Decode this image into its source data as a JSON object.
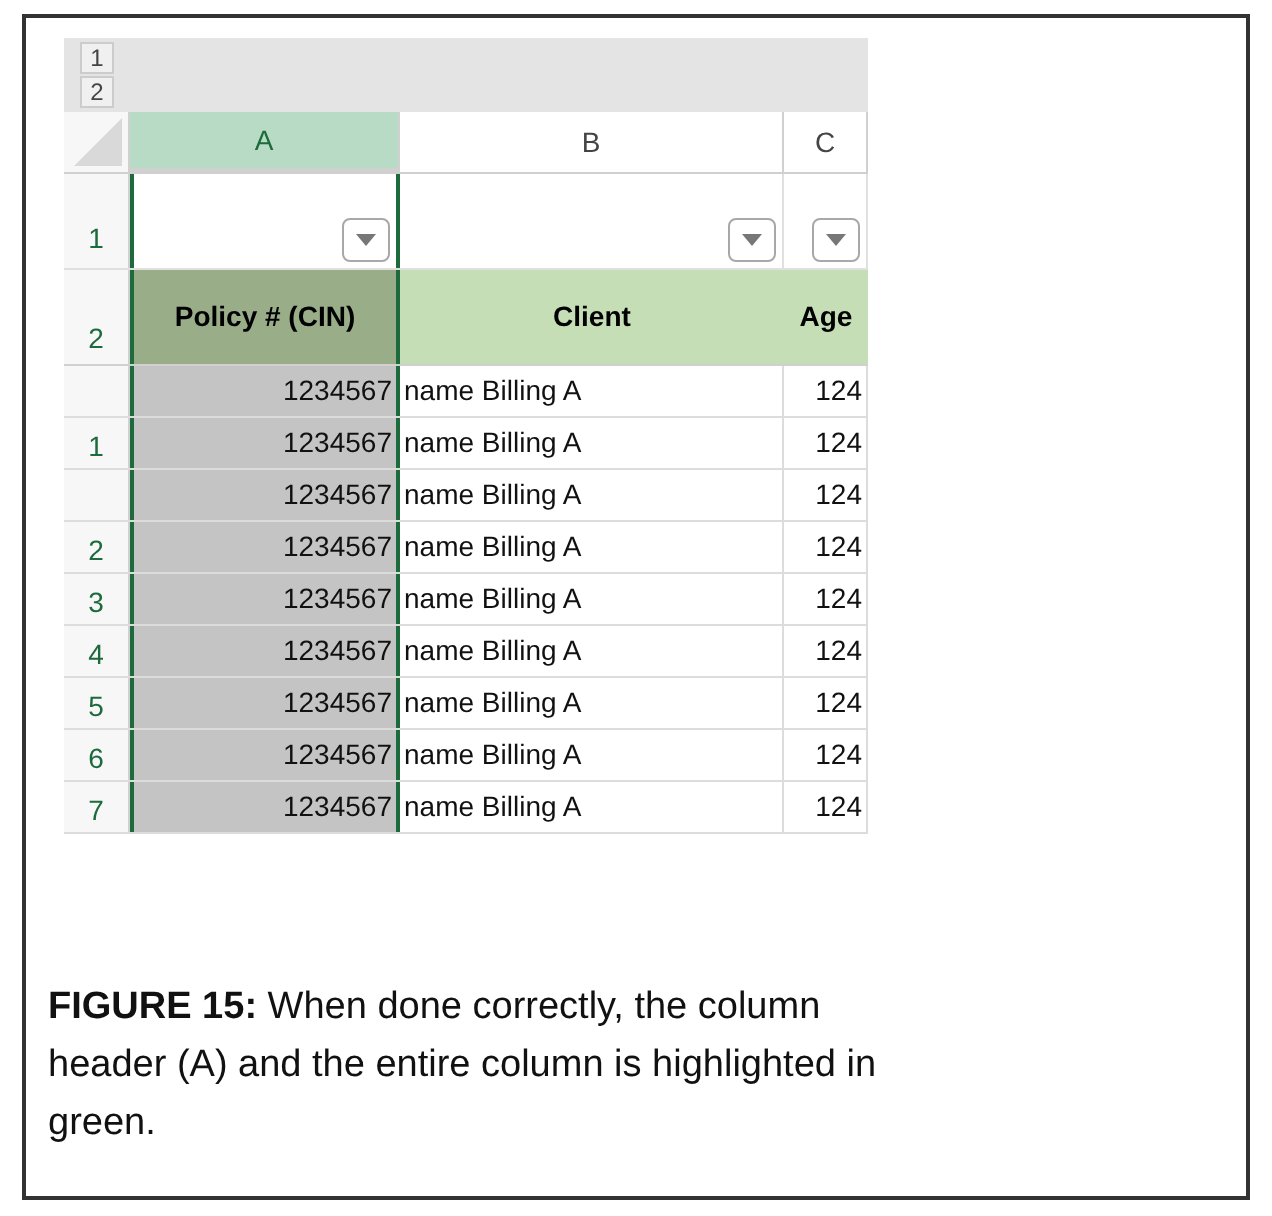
{
  "sheet": {
    "outline_levels": [
      "1",
      "2"
    ],
    "columns": [
      {
        "label": "A",
        "selected": true
      },
      {
        "label": "B",
        "selected": false
      },
      {
        "label": "C",
        "selected": false
      }
    ],
    "filter_row_label": "1",
    "header_row_label": "2",
    "headers": [
      "Policy # (CIN)",
      "Client",
      "Age"
    ],
    "rows": [
      {
        "row_label": "",
        "policy": "1234567",
        "client": "name Billing A",
        "age": "124"
      },
      {
        "row_label": "1",
        "policy": "1234567",
        "client": "name Billing A",
        "age": "124"
      },
      {
        "row_label": "",
        "policy": "1234567",
        "client": "name Billing A",
        "age": "124"
      },
      {
        "row_label": "2",
        "policy": "1234567",
        "client": "name Billing A",
        "age": "124"
      },
      {
        "row_label": "3",
        "policy": "1234567",
        "client": "name Billing A",
        "age": "124"
      },
      {
        "row_label": "4",
        "policy": "1234567",
        "client": "name Billing A",
        "age": "124"
      },
      {
        "row_label": "5",
        "policy": "1234567",
        "client": "name Billing A",
        "age": "124"
      },
      {
        "row_label": "6",
        "policy": "1234567",
        "client": "name Billing A",
        "age": "124"
      },
      {
        "row_label": "7",
        "policy": "1234567",
        "client": "name Billing A",
        "age": "124"
      }
    ]
  },
  "caption": "**FIGURE 15:**  When done correctly, the column header (A) and the entire column is highlighted in green."
}
